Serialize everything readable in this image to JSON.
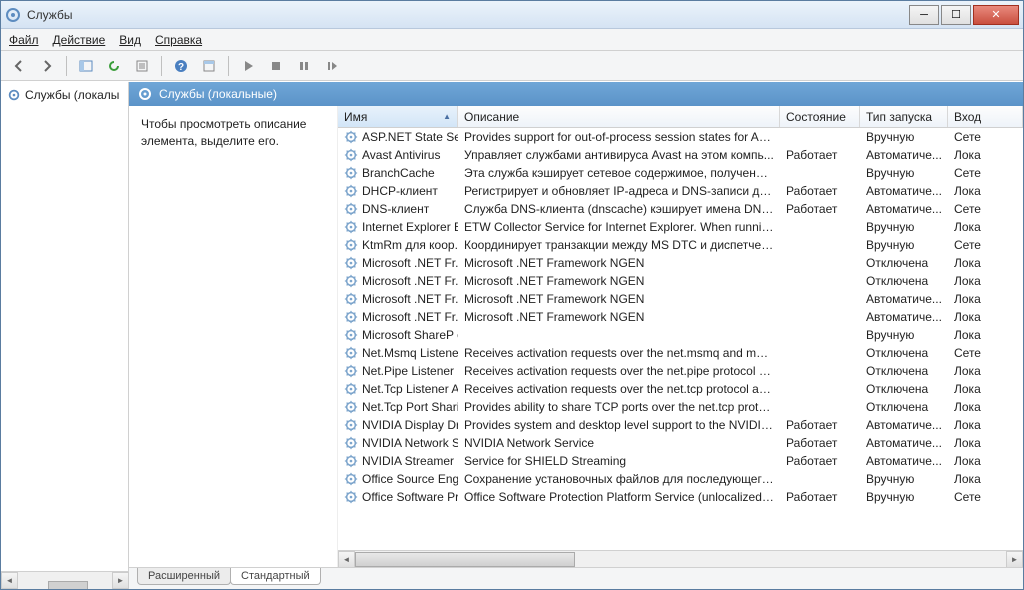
{
  "window": {
    "title": "Службы"
  },
  "menu": {
    "file": "Файл",
    "action": "Действие",
    "view": "Вид",
    "help": "Справка"
  },
  "tree": {
    "root": "Службы (локалы"
  },
  "panel": {
    "title": "Службы (локальные)"
  },
  "description": {
    "line1": "Чтобы просмотреть описание",
    "line2": "элемента, выделите его."
  },
  "columns": {
    "name": "Имя",
    "desc": "Описание",
    "state": "Состояние",
    "start": "Тип запуска",
    "login": "Вход"
  },
  "states": {
    "running": "Работает"
  },
  "startTypes": {
    "manual": "Вручную",
    "auto": "Автоматиче...",
    "disabled": "Отключена"
  },
  "logins": {
    "net": "Сете",
    "local": "Лока"
  },
  "services": [
    {
      "name": "ASP.NET State Ser...",
      "desc": "Provides support for out-of-process session states for ASP...",
      "state": "",
      "start": "manual",
      "login": "net"
    },
    {
      "name": "Avast Antivirus",
      "desc": "Управляет службами антивируса Avast на этом компь...",
      "state": "running",
      "start": "auto",
      "login": "local"
    },
    {
      "name": "BranchCache",
      "desc": "Эта служба кэширует сетевое содержимое, полученно...",
      "state": "",
      "start": "manual",
      "login": "net"
    },
    {
      "name": "DHCP-клиент",
      "desc": "Регистрирует и обновляет IP-адреса и DNS-записи для ...",
      "state": "running",
      "start": "auto",
      "login": "local"
    },
    {
      "name": "DNS-клиент",
      "desc": "Служба DNS-клиента (dnscache) кэширует имена DNS ...",
      "state": "running",
      "start": "auto",
      "login": "net"
    },
    {
      "name": "Internet Explorer E...",
      "desc": "ETW Collector Service for Internet Explorer. When running...",
      "state": "",
      "start": "manual",
      "login": "local"
    },
    {
      "name": "KtmRm для коор...",
      "desc": "Координирует транзакции между MS DTC и диспетчер...",
      "state": "",
      "start": "manual",
      "login": "net"
    },
    {
      "name": "Microsoft .NET Fr...",
      "desc": "Microsoft .NET Framework NGEN",
      "state": "",
      "start": "disabled",
      "login": "local"
    },
    {
      "name": "Microsoft .NET Fr...",
      "desc": "Microsoft .NET Framework NGEN",
      "state": "",
      "start": "disabled",
      "login": "local"
    },
    {
      "name": "Microsoft .NET Fr...",
      "desc": "Microsoft .NET Framework NGEN",
      "state": "",
      "start": "auto",
      "login": "local"
    },
    {
      "name": "Microsoft .NET Fr...",
      "desc": "Microsoft .NET Framework NGEN",
      "state": "",
      "start": "auto",
      "login": "local"
    },
    {
      "name": "Microsoft ShareP o...",
      "desc": "",
      "state": "",
      "start": "manual",
      "login": "local"
    },
    {
      "name": "Net.Msmq Listene...",
      "desc": "Receives activation requests over the net.msmq and msm...",
      "state": "",
      "start": "disabled",
      "login": "net"
    },
    {
      "name": "Net.Pipe Listener ...",
      "desc": "Receives activation requests over the net.pipe protocol an...",
      "state": "",
      "start": "disabled",
      "login": "local"
    },
    {
      "name": "Net.Tcp Listener A...",
      "desc": "Receives activation requests over the net.tcp protocol and...",
      "state": "",
      "start": "disabled",
      "login": "local"
    },
    {
      "name": "Net.Tcp Port Shari...",
      "desc": "Provides ability to share TCP ports over the net.tcp protoc...",
      "state": "",
      "start": "disabled",
      "login": "local"
    },
    {
      "name": "NVIDIA Display Dri...",
      "desc": "Provides system and desktop level support to the NVIDIA ...",
      "state": "running",
      "start": "auto",
      "login": "local"
    },
    {
      "name": "NVIDIA Network S...",
      "desc": "NVIDIA Network Service",
      "state": "running",
      "start": "auto",
      "login": "local"
    },
    {
      "name": "NVIDIA Streamer S...",
      "desc": "Service for SHIELD Streaming",
      "state": "running",
      "start": "auto",
      "login": "local"
    },
    {
      "name": "Office  Source Eng...",
      "desc": "Сохранение установочных файлов для последующего ...",
      "state": "",
      "start": "manual",
      "login": "local"
    },
    {
      "name": "Office Software Pr...",
      "desc": "Office Software Protection Platform Service (unlocalized d...",
      "state": "running",
      "start": "manual",
      "login": "net"
    }
  ],
  "tabs": {
    "extended": "Расширенный",
    "standard": "Стандартный"
  }
}
